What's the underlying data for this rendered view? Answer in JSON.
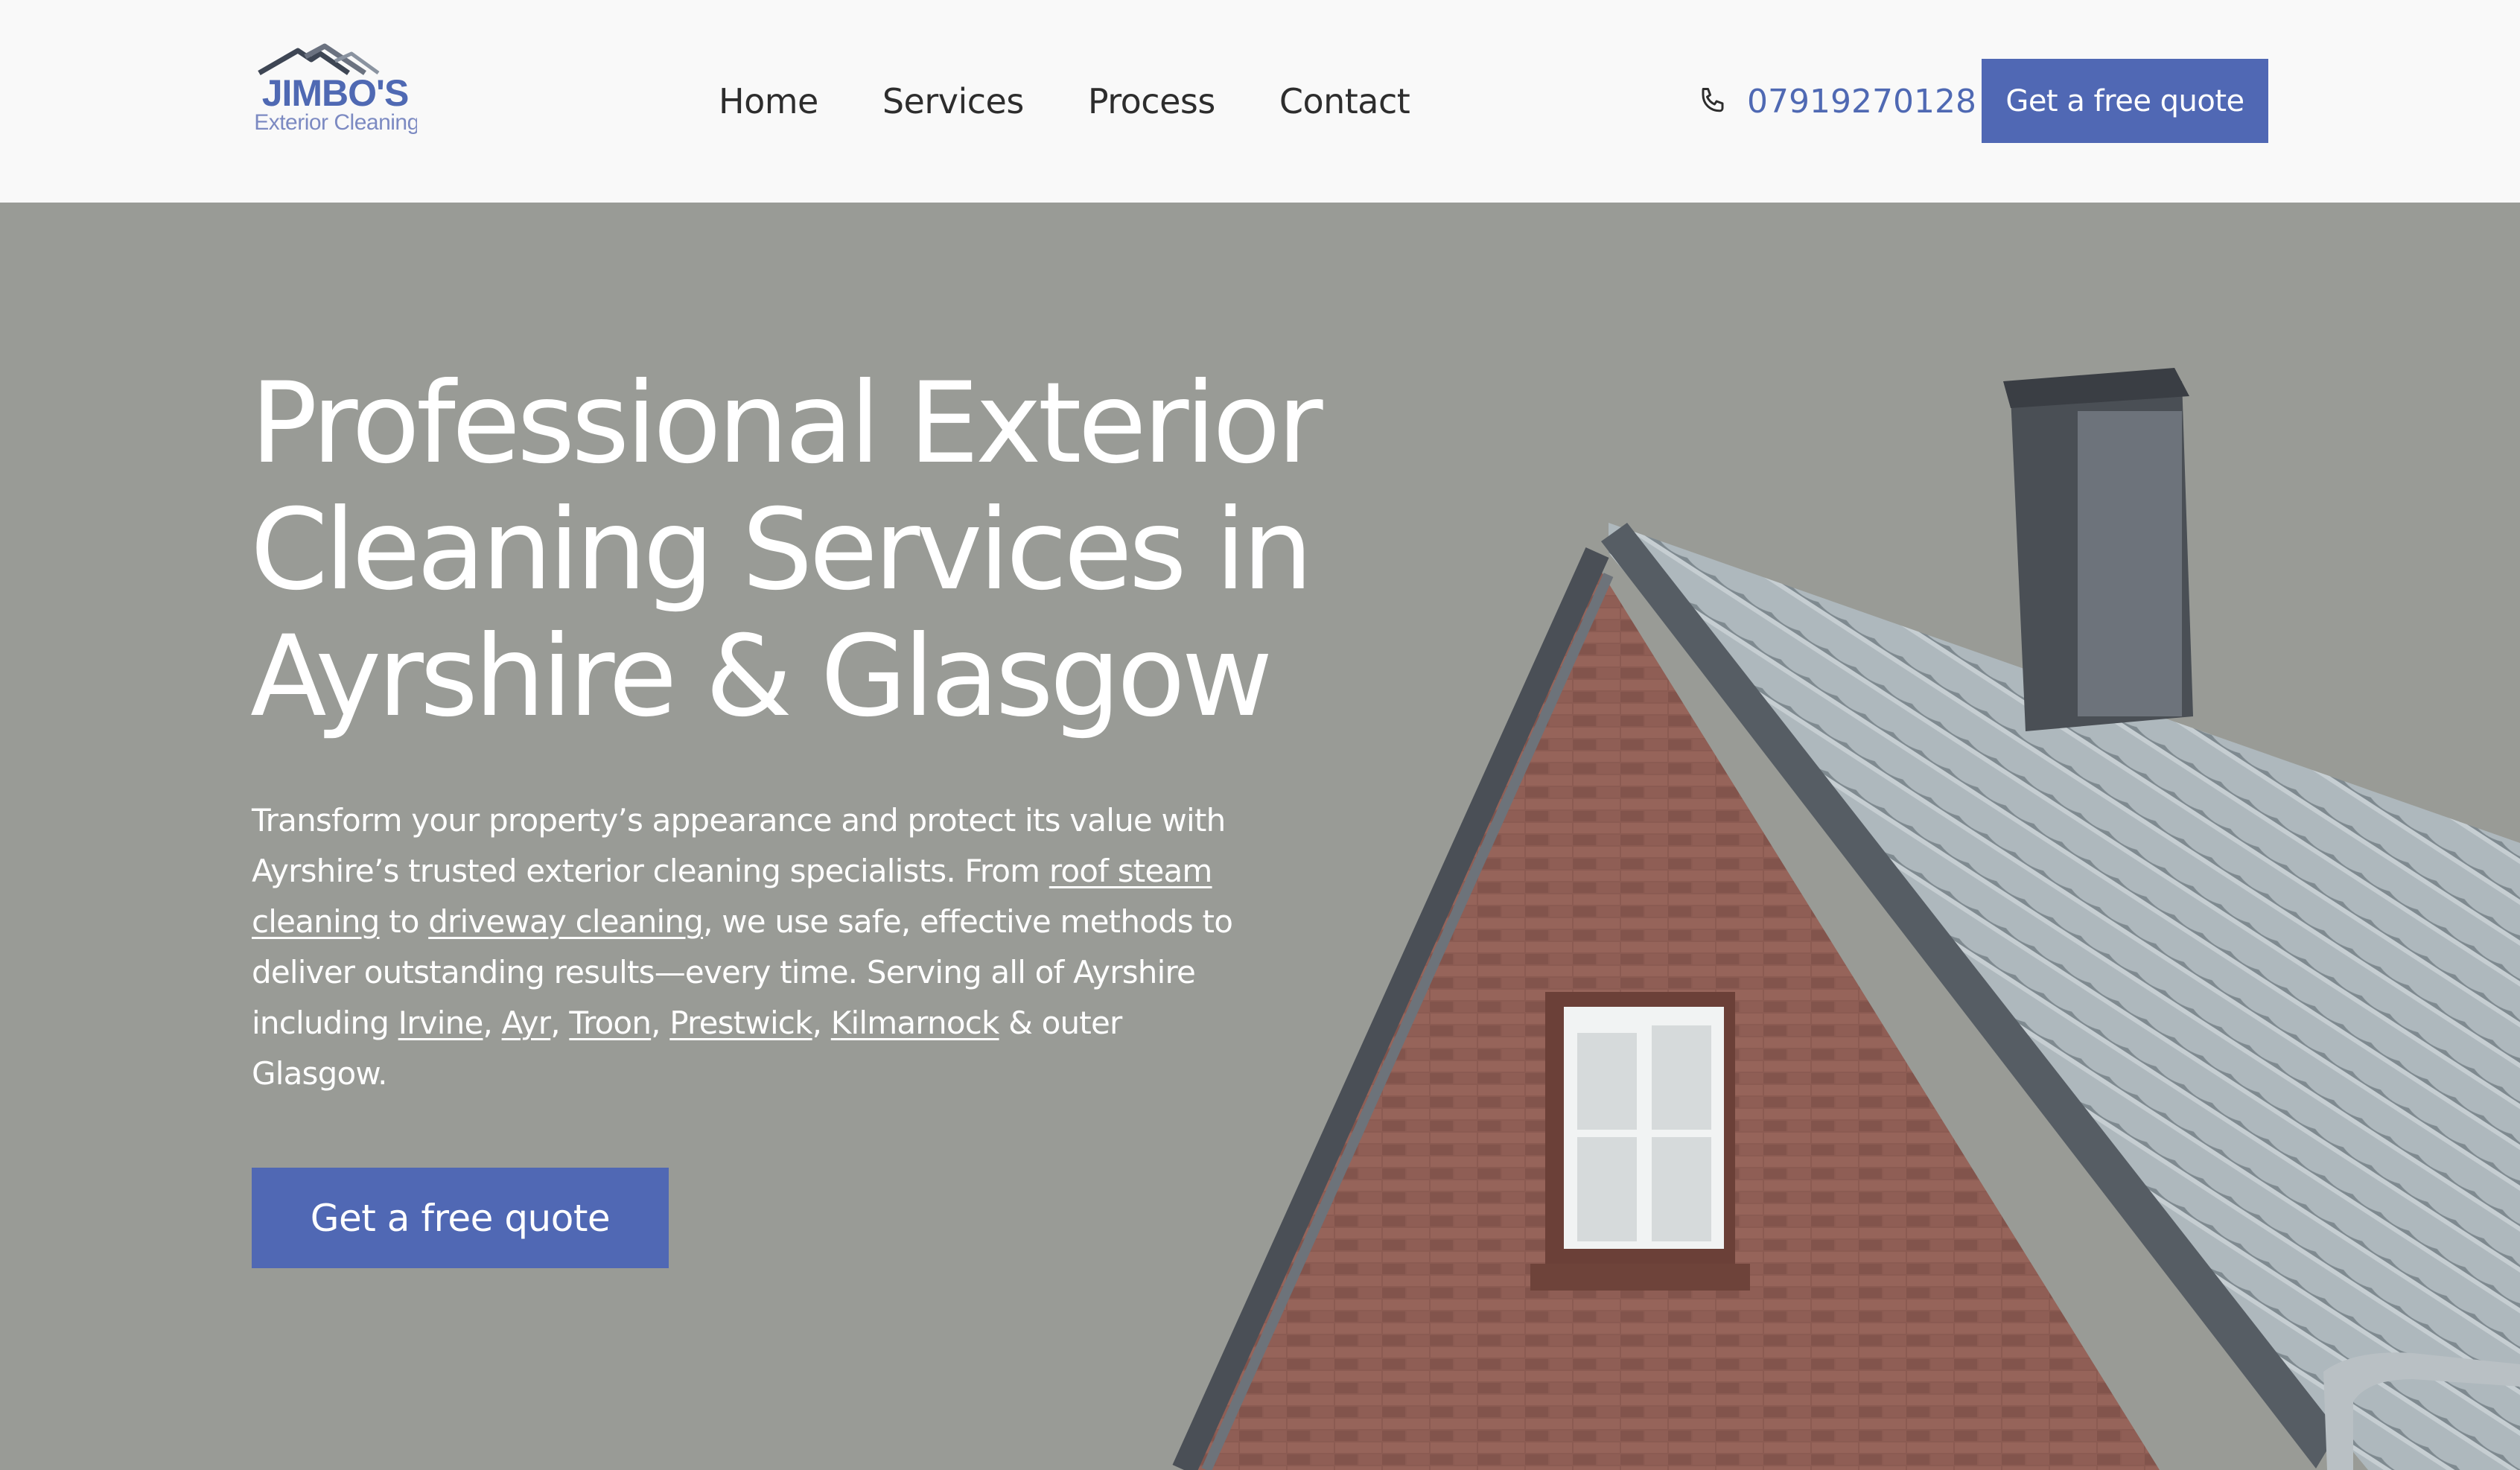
{
  "brand": {
    "name": "JIMBO'S",
    "tagline": "Exterior Cleaning",
    "icon": "house-roof-logo"
  },
  "nav": {
    "items": [
      {
        "label": "Home"
      },
      {
        "label": "Services"
      },
      {
        "label": "Process"
      },
      {
        "label": "Contact"
      }
    ]
  },
  "contact": {
    "phone_icon": "phone-icon",
    "phone": "07919270128"
  },
  "header_cta": {
    "label": "Get a free quote"
  },
  "hero": {
    "title": "Professional Exterior Cleaning Services in Ayrshire & Glasgow",
    "text": {
      "p1": "Transform your property’s appearance and protect its value with Ayrshire’s trusted exterior cleaning specialists. From ",
      "link_roof": "roof steam cleaning",
      "p2": " to ",
      "link_driveway": "driveway cleaning",
      "p3": ", we use safe, effective methods to deliver outstanding results—every time. Serving all of Ayrshire including ",
      "link_irvine": "Irvine",
      "sep1": ", ",
      "link_ayr": "Ayr",
      "sep2": ", ",
      "link_troon": "Troon",
      "sep3": ", ",
      "link_prestwick": "Prestwick",
      "sep4": ", ",
      "link_kilmarnock": "Kilmarnock",
      "p4": " & outer Glasgow."
    },
    "cta_label": "Get a free quote",
    "image": "brick-house-with-snowy-roof"
  },
  "colors": {
    "accent": "#5068b4",
    "phone_text": "#4f69b3",
    "header_bg": "#f9f9f9",
    "hero_bg": "#999b96",
    "brick": "#8a5a52",
    "roof": "#a9b3b8"
  }
}
